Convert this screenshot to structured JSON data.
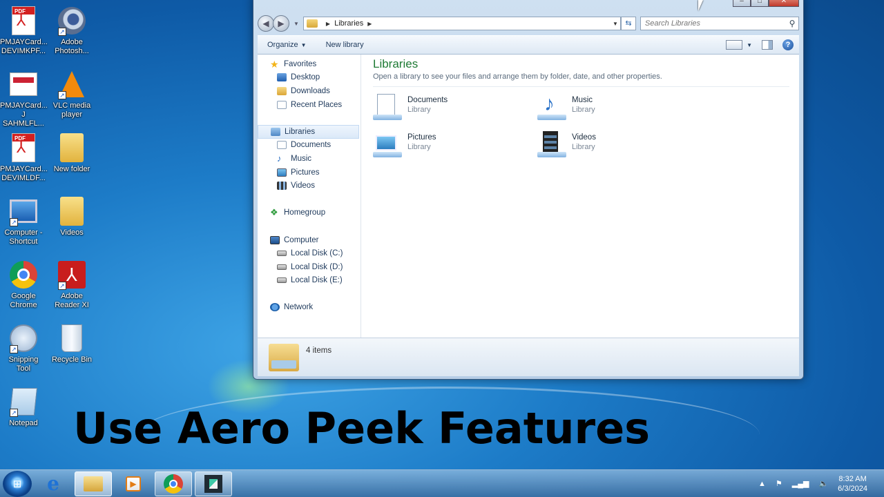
{
  "desktop": {
    "icons": [
      {
        "label": "PMJAYCard...\nDEVIMKPF...",
        "icon": "pdf-icon"
      },
      {
        "label": "Adobe\nPhotosh...",
        "icon": "photoshop-icon"
      },
      {
        "label": "PMJAYCard...\nJ SAHMLFL...",
        "icon": "document-icon"
      },
      {
        "label": "VLC media\nplayer",
        "icon": "vlc-icon"
      },
      {
        "label": "PMJAYCard...\nDEVIMLDF...",
        "icon": "pdf-icon"
      },
      {
        "label": "New folder",
        "icon": "folder-icon"
      },
      {
        "label": "Computer -\nShortcut",
        "icon": "computer-icon"
      },
      {
        "label": "Videos",
        "icon": "folder-icon"
      },
      {
        "label": "Google\nChrome",
        "icon": "chrome-icon"
      },
      {
        "label": "Adobe\nReader XI",
        "icon": "adobe-reader-icon"
      },
      {
        "label": "Snipping\nTool",
        "icon": "snipping-tool-icon"
      },
      {
        "label": "Recycle Bin",
        "icon": "recycle-bin-icon"
      },
      {
        "label": "Notepad",
        "icon": "notepad-icon"
      }
    ]
  },
  "explorer": {
    "address": {
      "crumb": "Libraries"
    },
    "search": {
      "placeholder": "Search Libraries"
    },
    "commands": {
      "organize": "Organize",
      "new_library": "New library"
    },
    "nav": {
      "favorites": "Favorites",
      "desktop": "Desktop",
      "downloads": "Downloads",
      "recent": "Recent Places",
      "libraries": "Libraries",
      "documents": "Documents",
      "music": "Music",
      "pictures": "Pictures",
      "videos": "Videos",
      "homegroup": "Homegroup",
      "computer": "Computer",
      "disk_c": "Local Disk (C:)",
      "disk_d": "Local Disk (D:)",
      "disk_e": "Local Disk (E:)",
      "network": "Network"
    },
    "main": {
      "title": "Libraries",
      "description": "Open a library to see your files and arrange them by folder, date, and other properties.",
      "items": [
        {
          "name": "Documents",
          "type": "Library"
        },
        {
          "name": "Music",
          "type": "Library"
        },
        {
          "name": "Pictures",
          "type": "Library"
        },
        {
          "name": "Videos",
          "type": "Library"
        }
      ]
    },
    "details": {
      "count": "4 items"
    }
  },
  "caption": "Use Aero Peek Features",
  "taskbar": {
    "clock": {
      "time": "8:32 AM",
      "date": "6/3/2024"
    }
  },
  "colors": {
    "accent_green": "#1e7a34",
    "taskbar": "#3c6ea0"
  }
}
